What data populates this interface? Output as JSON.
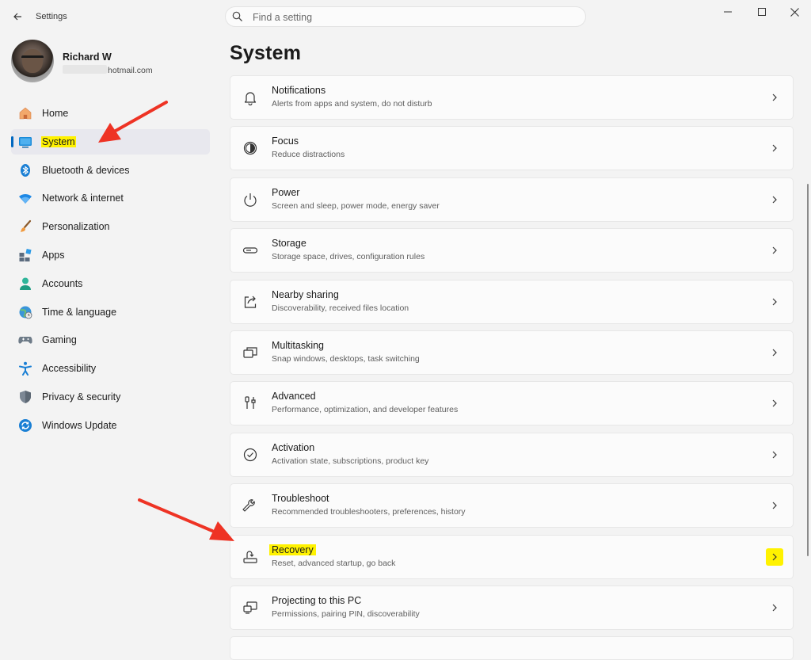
{
  "app": {
    "title": "Settings"
  },
  "search": {
    "placeholder": "Find a setting"
  },
  "profile": {
    "name": "Richard W",
    "email_domain": "hotmail.com"
  },
  "sidebar": {
    "items": [
      {
        "label": "Home",
        "icon": "home-icon"
      },
      {
        "label": "System",
        "icon": "system-icon",
        "active": true
      },
      {
        "label": "Bluetooth & devices",
        "icon": "bluetooth-icon"
      },
      {
        "label": "Network & internet",
        "icon": "wifi-icon"
      },
      {
        "label": "Personalization",
        "icon": "brush-icon"
      },
      {
        "label": "Apps",
        "icon": "apps-icon"
      },
      {
        "label": "Accounts",
        "icon": "accounts-icon"
      },
      {
        "label": "Time & language",
        "icon": "globe-clock-icon"
      },
      {
        "label": "Gaming",
        "icon": "gamepad-icon"
      },
      {
        "label": "Accessibility",
        "icon": "accessibility-icon"
      },
      {
        "label": "Privacy & security",
        "icon": "shield-icon"
      },
      {
        "label": "Windows Update",
        "icon": "update-icon"
      }
    ]
  },
  "main": {
    "title": "System",
    "cards": [
      {
        "title": "Notifications",
        "subtitle": "Alerts from apps and system, do not disturb",
        "icon": "bell-icon"
      },
      {
        "title": "Focus",
        "subtitle": "Reduce distractions",
        "icon": "focus-icon"
      },
      {
        "title": "Power",
        "subtitle": "Screen and sleep, power mode, energy saver",
        "icon": "power-icon"
      },
      {
        "title": "Storage",
        "subtitle": "Storage space, drives, configuration rules",
        "icon": "storage-icon"
      },
      {
        "title": "Nearby sharing",
        "subtitle": "Discoverability, received files location",
        "icon": "share-icon"
      },
      {
        "title": "Multitasking",
        "subtitle": "Snap windows, desktops, task switching",
        "icon": "multitask-icon"
      },
      {
        "title": "Advanced",
        "subtitle": "Performance, optimization, and developer features",
        "icon": "tools-icon"
      },
      {
        "title": "Activation",
        "subtitle": "Activation state, subscriptions, product key",
        "icon": "check-circle-icon"
      },
      {
        "title": "Troubleshoot",
        "subtitle": "Recommended troubleshooters, preferences, history",
        "icon": "wrench-icon"
      },
      {
        "title": "Recovery",
        "subtitle": "Reset, advanced startup, go back",
        "icon": "recovery-icon",
        "highlighted": true
      },
      {
        "title": "Projecting to this PC",
        "subtitle": "Permissions, pairing PIN, discoverability",
        "icon": "projecting-icon"
      }
    ]
  },
  "colors": {
    "accent": "#0067c0",
    "highlight": "#fff200",
    "annotation_arrow": "#ee3324"
  }
}
